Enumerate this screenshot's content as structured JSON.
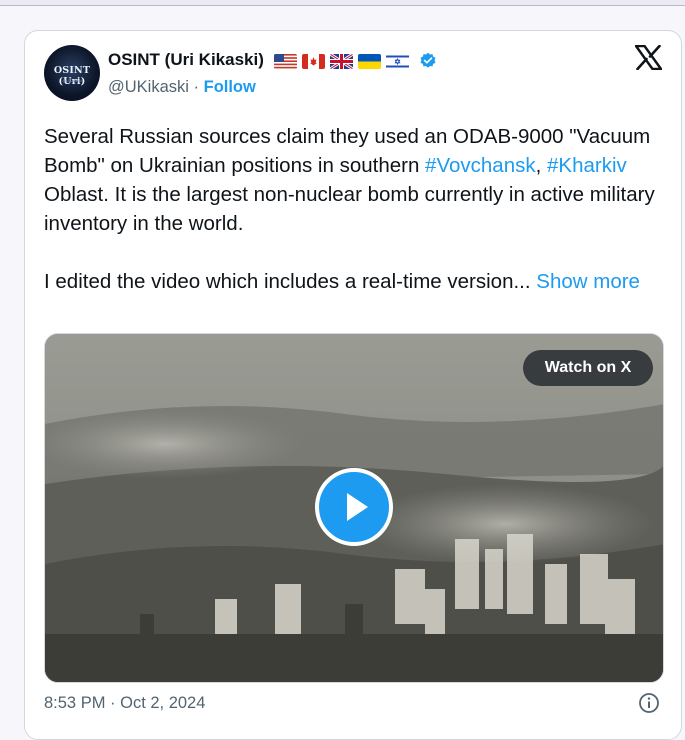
{
  "tweet": {
    "author": {
      "name": "OSINT (Uri Kikaski)",
      "handle": "@UKikaski",
      "separator": " · ",
      "follow_label": "Follow",
      "avatar_text": "OSINT (Uri)",
      "avatar_subtext": "@UKikaski",
      "flags": [
        "us-flag-icon",
        "canada-flag-icon",
        "uk-flag-icon",
        "ukraine-flag-icon",
        "israel-flag-icon"
      ],
      "verified": true
    },
    "text": {
      "p1_before": "Several Russian sources claim they used an ODAB-9000 \"Vacuum Bomb\" on Ukrainian positions in southern ",
      "hashtag_1": "#Vovchansk",
      "comma": ", ",
      "hashtag_2": "#Kharkiv",
      "p1_after": " Oblast. It is the largest non-nuclear bomb currently in active military inventory in the world.",
      "p2": "I edited the video which includes a real-time version... ",
      "show_more": "Show more"
    },
    "media": {
      "watch_label": "Watch on X",
      "play_icon": "play-icon"
    },
    "timestamp": "8:53 PM · Oct 2, 2024",
    "icons": {
      "platform": "x-logo-icon",
      "info": "info-icon"
    },
    "colors": {
      "accent": "#1d9bf0",
      "text": "#0f1419",
      "muted": "#536471",
      "border": "#cfd9de"
    }
  }
}
